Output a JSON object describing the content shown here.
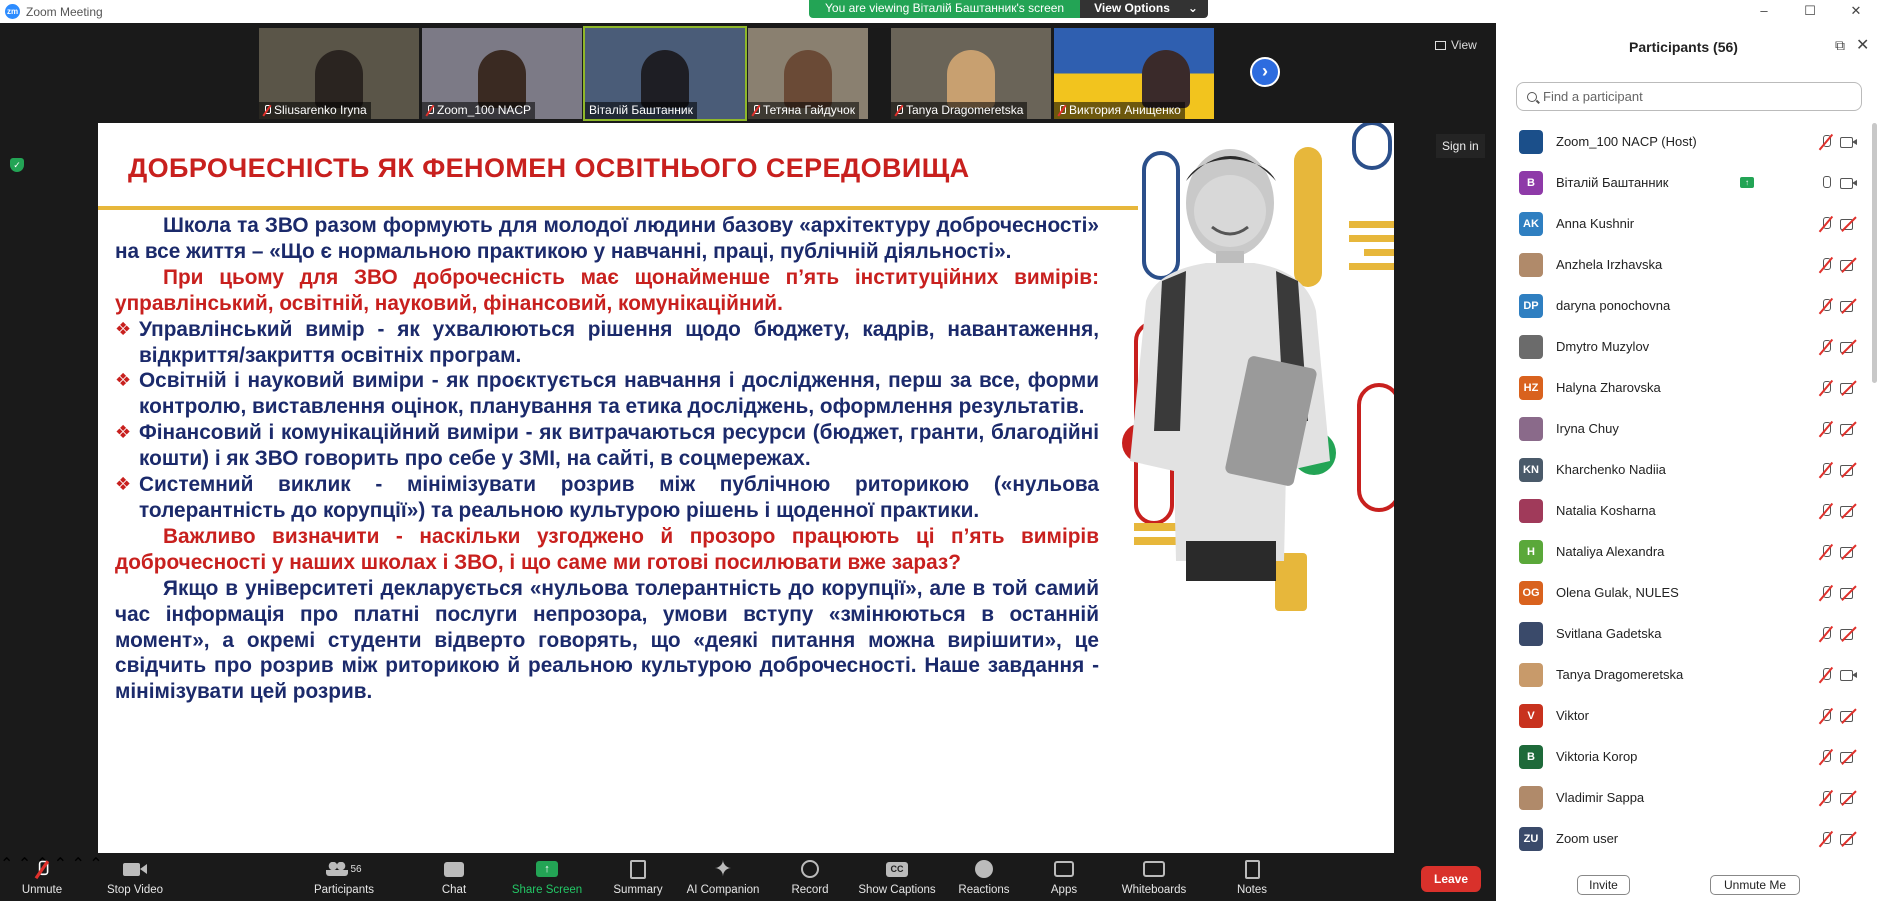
{
  "window": {
    "title": "Zoom Meeting",
    "controls": [
      "–",
      "☐",
      "✕"
    ]
  },
  "banner": {
    "message": "You are viewing Віталій Баштанник's screen",
    "options_label": "View Options"
  },
  "view_button": {
    "label": "View"
  },
  "signin_button": {
    "label": "Sign in"
  },
  "thumbnails": [
    {
      "name": "Sliusarenko Iryna",
      "muted": true
    },
    {
      "name": "Zoom_100 NACP",
      "muted": true
    },
    {
      "name": "Віталій Баштанник",
      "muted": false
    },
    {
      "name": "Тетяна Гайдучок",
      "muted": true
    },
    {
      "name": "Tanya Dragomeretska",
      "muted": true
    },
    {
      "name": "Виктория Анищенко",
      "muted": true
    }
  ],
  "slide": {
    "title": "ДОБРОЧЕСНІСТЬ ЯК ФЕНОМЕН ОСВІТНЬОГО СЕРЕДОВИЩА",
    "para1": "Школа та ЗВО разом формують для молодої людини базову «архітектуру доброчесності» на все життя – «Що є нормальною практикою у навчанні, праці, публічній діяльності».",
    "para2": "При цьому для ЗВО доброчесність має щонайменше п’ять інституційних вимірів: управлінський, освітній, науковий, фінансовий, комунікаційний.",
    "bullets": [
      "Управлінський вимір - як ухвалюються рішення щодо бюджету, кадрів, навантаження, відкриття/закриття освітніх програм.",
      "Освітній і науковий виміри - як проєктується навчання і дослідження, перш за все,  форми контролю, виставлення оцінок, планування та етика досліджень, оформлення результатів.",
      "Фінансовий і комунікаційний виміри - як витрачаються ресурси (бюджет, гранти, благодійні кошти) і як ЗВО говорить про себе у ЗМІ, на сайті, в соцмережах.",
      "Системний виклик - мінімізувати розрив між публічною риторикою («нульова толерантність до корупції») та реальною культурою рішень і щоденної практики."
    ],
    "para3": "Важливо визначити - наскільки узгоджено й прозоро працюють ці п’ять вимірів доброчесності у наших школах і ЗВО, і що саме ми готові посилювати вже зараз?",
    "para4": "Якщо в університеті декларується «нульова толерантність до корупції», але в той самий час інформація про платні послуги непрозора, умови вступу «змінюються в останній момент», а окремі студенти відверто говорять, що «деякі питання можна вирішити», це свідчить про розрив між риторикою й реальною культурою доброчесності. Наше завдання - мінімізувати цей розрив.",
    "colors": {
      "title": "#c8201e",
      "body": "#1b2a6b",
      "accent": "#e7b73b"
    }
  },
  "panel": {
    "title": "Participants (56)",
    "search_placeholder": "Find a participant",
    "participants": [
      {
        "name": "Zoom_100 NACP (Host)",
        "initials": "",
        "avatar_color": "#1b4f8a",
        "mic": "muted",
        "cam": "on",
        "sharing": false
      },
      {
        "name": "Віталій Баштанник",
        "initials": "В",
        "avatar_color": "#8e3aa8",
        "mic": "on",
        "cam": "on",
        "sharing": true
      },
      {
        "name": "Anna Kushnir",
        "initials": "AK",
        "avatar_color": "#2f7fc1",
        "mic": "muted",
        "cam": "off",
        "sharing": false
      },
      {
        "name": "Anzhela Irzhavska",
        "initials": "",
        "avatar_color": "#b08a6a",
        "mic": "muted",
        "cam": "off",
        "sharing": false
      },
      {
        "name": "daryna ponochovna",
        "initials": "DP",
        "avatar_color": "#2f7fc1",
        "mic": "muted",
        "cam": "off",
        "sharing": false
      },
      {
        "name": "Dmytro Muzylov",
        "initials": "",
        "avatar_color": "#6b6b6b",
        "mic": "muted",
        "cam": "off",
        "sharing": false
      },
      {
        "name": "Halyna Zharovska",
        "initials": "HZ",
        "avatar_color": "#d9621e",
        "mic": "muted",
        "cam": "off",
        "sharing": false
      },
      {
        "name": "Iryna Chuy",
        "initials": "",
        "avatar_color": "#8a6a8a",
        "mic": "muted",
        "cam": "off",
        "sharing": false
      },
      {
        "name": "Kharchenko Nadiia",
        "initials": "KN",
        "avatar_color": "#4a5a6a",
        "mic": "muted",
        "cam": "off",
        "sharing": false
      },
      {
        "name": "Natalia Kosharna",
        "initials": "",
        "avatar_color": "#a03a5a",
        "mic": "muted",
        "cam": "off",
        "sharing": false
      },
      {
        "name": "Nataliya Alexandra",
        "initials": "H",
        "avatar_color": "#5aa83a",
        "mic": "muted",
        "cam": "off",
        "sharing": false
      },
      {
        "name": "Olena Gulak, NULES",
        "initials": "OG",
        "avatar_color": "#d9621e",
        "mic": "muted",
        "cam": "off",
        "sharing": false
      },
      {
        "name": "Svitlana Gadetska",
        "initials": "",
        "avatar_color": "#3a4a6a",
        "mic": "muted",
        "cam": "off",
        "sharing": false
      },
      {
        "name": "Tanya Dragomeretska",
        "initials": "",
        "avatar_color": "#c89a6a",
        "mic": "muted",
        "cam": "on",
        "sharing": false
      },
      {
        "name": "Viktor",
        "initials": "V",
        "avatar_color": "#c8321e",
        "mic": "muted",
        "cam": "off",
        "sharing": false
      },
      {
        "name": "Viktoria Korop",
        "initials": "B",
        "avatar_color": "#1e6a3a",
        "mic": "muted",
        "cam": "off",
        "sharing": false
      },
      {
        "name": "Vladimir Sappa",
        "initials": "",
        "avatar_color": "#b08a6a",
        "mic": "muted",
        "cam": "off",
        "sharing": false
      },
      {
        "name": "Zoom user",
        "initials": "ZU",
        "avatar_color": "#3a4a6a",
        "mic": "muted",
        "cam": "off",
        "sharing": false
      }
    ],
    "invite_label": "Invite",
    "unmute_me_label": "Unmute Me"
  },
  "toolbar": {
    "unmute": "Unmute",
    "stop_video": "Stop Video",
    "participants": "Participants",
    "participants_count": "56",
    "chat": "Chat",
    "share_screen": "Share Screen",
    "summary": "Summary",
    "ai_companion": "AI Companion",
    "record": "Record",
    "show_captions": "Show Captions",
    "reactions": "Reactions",
    "apps": "Apps",
    "whiteboards": "Whiteboards",
    "notes": "Notes",
    "leave": "Leave"
  }
}
